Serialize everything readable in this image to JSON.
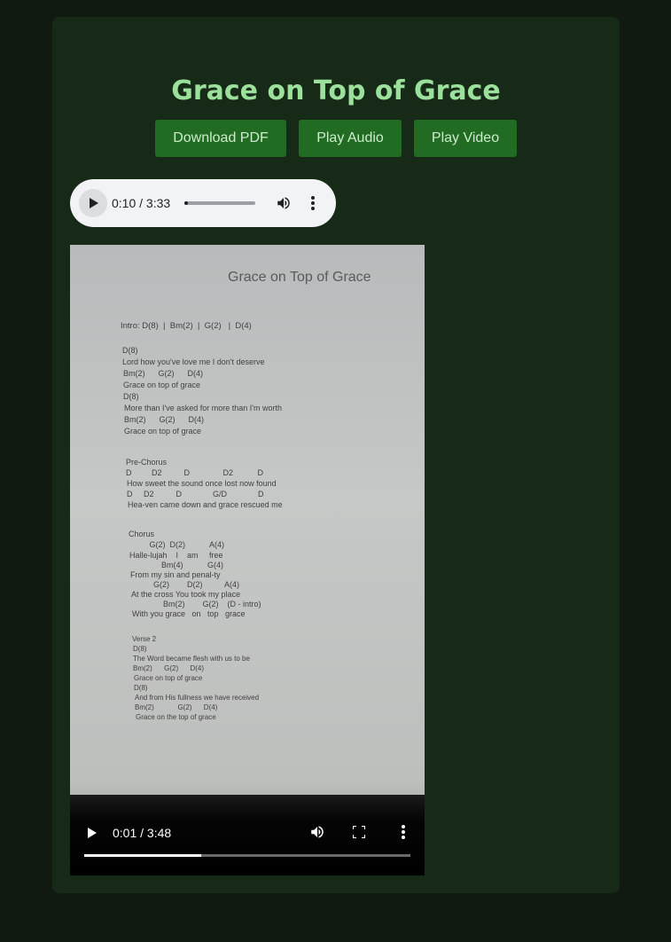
{
  "page": {
    "title": "Grace on Top of Grace"
  },
  "buttons": {
    "download_pdf": "Download PDF",
    "play_audio": "Play Audio",
    "play_video": "Play Video"
  },
  "audio_player": {
    "time": "0:10 / 3:33",
    "progress": 0.047,
    "icons": [
      "play-icon",
      "volume-icon",
      "more-options-icon"
    ]
  },
  "video_player": {
    "time": "0:01 / 3:48",
    "progress": 0.36,
    "icons": [
      "play-icon",
      "volume-icon",
      "fullscreen-icon",
      "more-options-icon"
    ]
  },
  "sheet": {
    "title": "Grace on Top of Grace",
    "lines": [
      "Intro: D(8)  |  Bm(2)  |  G(2)   |  D(4)",
      "D(8)",
      "Lord how you've love me I don't deserve",
      "Bm(2)      G(2)      D(4)",
      "Grace on top of grace",
      "D(8)",
      "More than I've asked for more than I'm worth",
      "Bm(2)      G(2)      D(4)",
      "Grace on top of grace",
      "Pre-Chorus",
      "D         D2          D               D2           D",
      "How sweet the sound once lost now found",
      "D     D2          D              G/D              D",
      "Hea-ven came down and grace rescued me",
      "Chorus",
      "         G(2)  D(2)           A(4)",
      "Halle-lujah    I    am     free",
      "              Bm(4)           G(4)",
      "From my sin and penal-ty",
      "          G(2)        D(2)          A(4)",
      "At the cross You took my place",
      "              Bm(2)        G(2)    (D - intro)",
      "With you grace   on   top   grace",
      "Verse 2",
      "D(8)",
      "The Word became flesh with us to be",
      "Bm(2)      G(2)      D(4)",
      "Grace on top of grace",
      "D(8)",
      "And from His fullness we have received",
      "Bm(2)            G(2)      D(4)",
      "Grace on the top of grace"
    ]
  },
  "colors": {
    "background": "#101a10",
    "card": "#172a17",
    "accent": "#9be09b",
    "button": "#226b22"
  }
}
